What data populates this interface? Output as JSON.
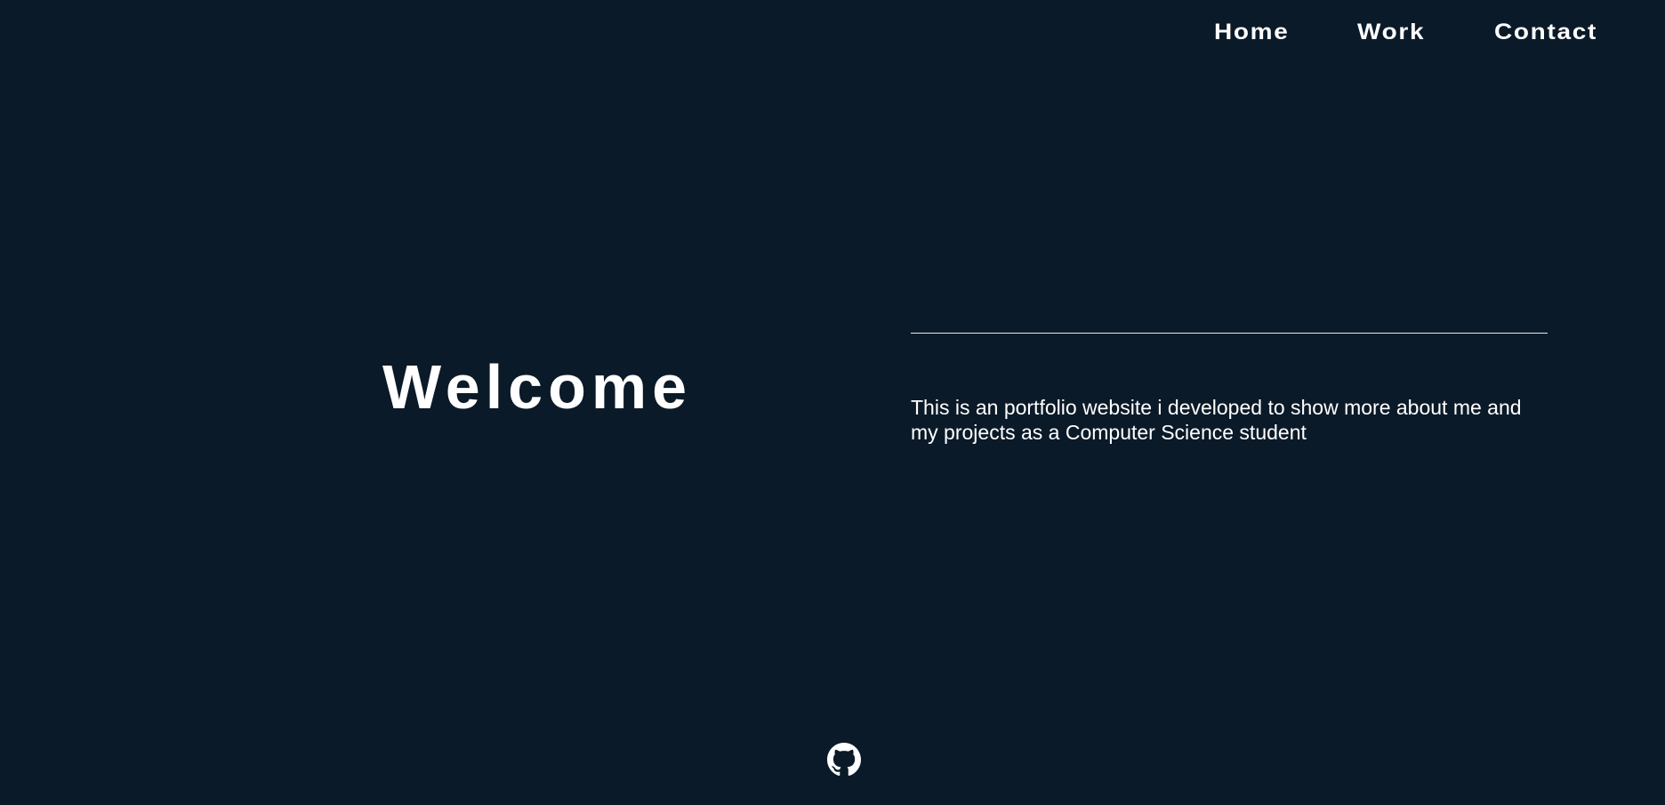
{
  "nav": {
    "items": [
      {
        "label": "Home"
      },
      {
        "label": "Work"
      },
      {
        "label": "Contact"
      }
    ]
  },
  "hero": {
    "title": "Welcome",
    "description": "This is an portfolio website i developed to show more about me and my projects as a Computer Science student"
  },
  "footer": {
    "icons": [
      "github-icon"
    ]
  },
  "colors": {
    "background": "#0b1a28",
    "text": "#ffffff",
    "divider": "#e8eaed"
  }
}
